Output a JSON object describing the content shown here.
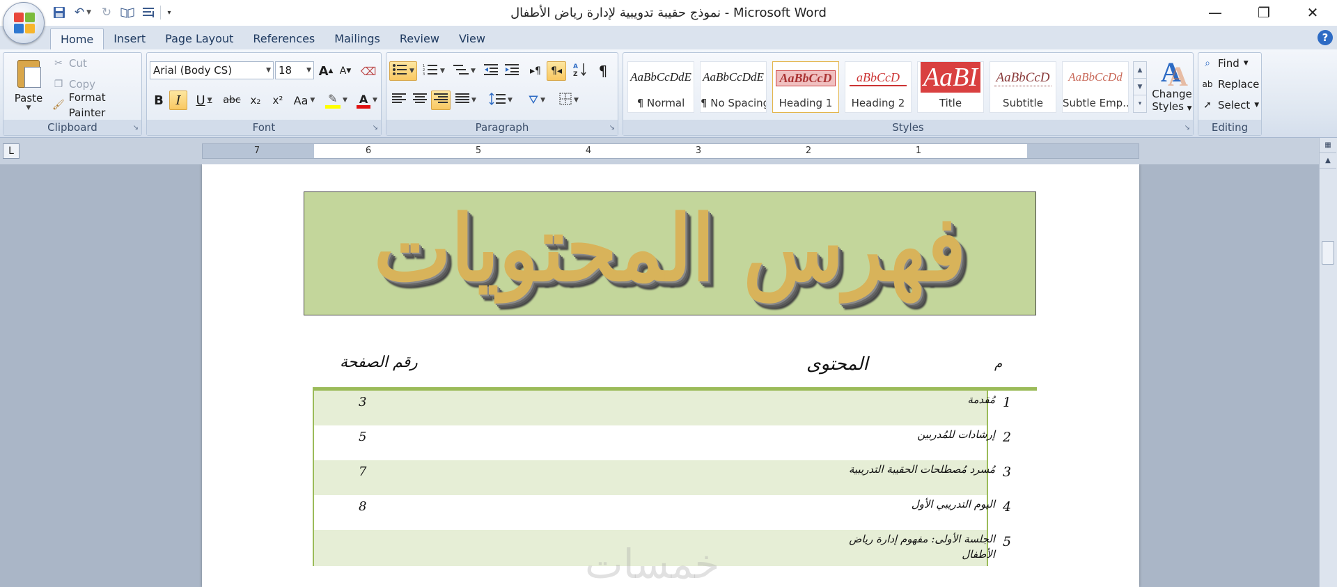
{
  "window": {
    "title": "نموذج حقيبة تدويبية لإدارة رياض الأطفال - Microsoft Word",
    "controls": [
      "—",
      "❐",
      "✕"
    ]
  },
  "qat": {
    "icons": [
      "save-icon",
      "undo-icon",
      "redo-icon",
      "book-icon",
      "list-icon",
      "customize-icon"
    ]
  },
  "tabs": [
    "Home",
    "Insert",
    "Page Layout",
    "References",
    "Mailings",
    "Review",
    "View"
  ],
  "active_tab": "Home",
  "ribbon": {
    "clipboard": {
      "label": "Clipboard",
      "paste": "Paste",
      "cut": "Cut",
      "copy": "Copy",
      "format_painter": "Format Painter"
    },
    "font": {
      "label": "Font",
      "font_name": "Arial (Body CS)",
      "font_size": "18",
      "grow_label": "A",
      "shrink_label": "A",
      "bold": "B",
      "italic": "I",
      "underline": "U",
      "strike": "abc",
      "subscript": "x₂",
      "superscript": "x²",
      "change_case": "Aa",
      "font_color_label": "A",
      "highlight_color": "#ffff00",
      "font_color": "#e01010"
    },
    "paragraph": {
      "label": "Paragraph",
      "pilcrow": "¶"
    },
    "styles": {
      "label": "Styles",
      "items": [
        {
          "preview": "AaBbCcDdE",
          "name": "¶ Normal"
        },
        {
          "preview": "AaBbCcDdE",
          "name": "¶ No Spacing"
        },
        {
          "preview": "AaBbCcD",
          "name": "Heading 1"
        },
        {
          "preview": "aBbCcD",
          "name": "Heading 2"
        },
        {
          "preview": "AaBI",
          "name": "Title"
        },
        {
          "preview": "AaBbCcD",
          "name": "Subtitle"
        },
        {
          "preview": "AaBbCcDd",
          "name": "Subtle Emp..."
        }
      ],
      "change_styles_line1": "Change",
      "change_styles_line2": "Styles"
    },
    "editing": {
      "label": "Editing",
      "find": "Find",
      "replace": "Replace",
      "select": "Select"
    }
  },
  "ruler": {
    "tab_selector": "L",
    "numbers": [
      "7",
      "6",
      "5",
      "4",
      "3",
      "2",
      "1"
    ]
  },
  "document": {
    "banner_title": "فهرس المحتويات",
    "header_page": "رقم الصفحة",
    "header_content": "المحتوى",
    "header_index": "م",
    "rows": [
      {
        "idx": "1",
        "title": "مُقدمة",
        "page": "3"
      },
      {
        "idx": "2",
        "title": "إرشادات للمُدربين",
        "page": "5"
      },
      {
        "idx": "3",
        "title": "مُسرد مُصطلحات الحقيبة التدريبية",
        "page": "7"
      },
      {
        "idx": "4",
        "title": "اليوم التدريبي الأول",
        "page": "8"
      },
      {
        "idx": "5",
        "title": "الجلسة الأولى: مفهوم إدارة رياض الأطفال",
        "page": ""
      }
    ],
    "watermark": "خمسات"
  },
  "colors": {
    "banner_bg": "#c3d69b",
    "table_accent": "#9bbb59",
    "row_shade": "#e6eed6"
  }
}
